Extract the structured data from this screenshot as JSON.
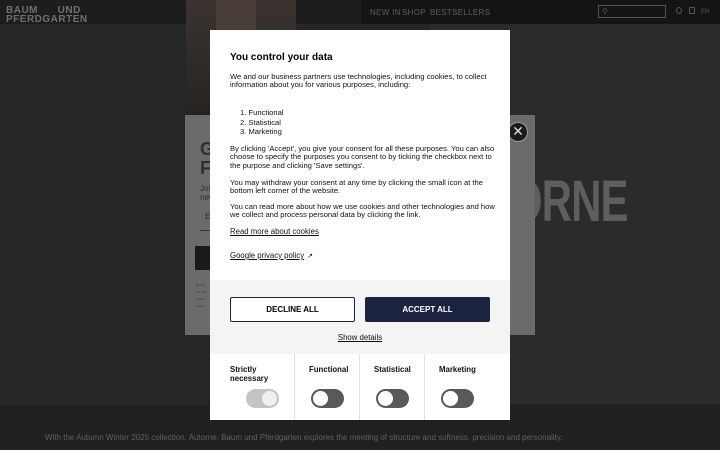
{
  "header": {
    "logo_line1": "BAUM",
    "logo_line1b": "UND",
    "logo_line2": "PFERDGARTEN",
    "nav": [
      "NEW IN",
      "SHOP",
      "BESTSELLERS"
    ],
    "search_icon": "search-icon",
    "lang": "EN"
  },
  "hero": {
    "word": "ORNE",
    "caption": "With the Autumn Winter 2025 collection, Autorne, Baum und Pferdgarten explores the meeting of structure and softness, precision and personality."
  },
  "newsletter": {
    "title_line1": "G",
    "title_line2": "F",
    "text_line1": "Joi",
    "text_line2": "nev",
    "field": "E",
    "small_text": "By sig... informa... emails... reguir..."
  },
  "cookie_modal": {
    "title": "You control your data",
    "intro": "We and our business partners use technologies, including cookies, to collect information about you for various purposes, including:",
    "purposes": [
      "Functional",
      "Statistical",
      "Marketing"
    ],
    "para_consent": "By clicking 'Accept', you give your consent for all these purposes. You can also choose to specify the purposes you consent to by ticking the checkbox next to the purpose and clicking 'Save settings'.",
    "para_withdraw": "You may withdraw your consent at any time by clicking the small icon at the bottom left corner of the website.",
    "para_read": "You can read more about how we use cookies and other technologies and how we collect and process personal data by clicking the link.",
    "link_cookies": "Read more about cookies",
    "link_privacy": "Google privacy policy",
    "decline_label": "DECLINE ALL",
    "accept_label": "ACCEPT ALL",
    "show_details_label": "Show details",
    "categories": [
      {
        "label": "Strictly necessary",
        "enabled": true,
        "locked": true
      },
      {
        "label": "Functional",
        "enabled": false,
        "locked": false
      },
      {
        "label": "Statistical",
        "enabled": false,
        "locked": false
      },
      {
        "label": "Marketing",
        "enabled": false,
        "locked": false
      }
    ]
  },
  "colors": {
    "accent": "#1c2340",
    "overlay": "#262626"
  }
}
